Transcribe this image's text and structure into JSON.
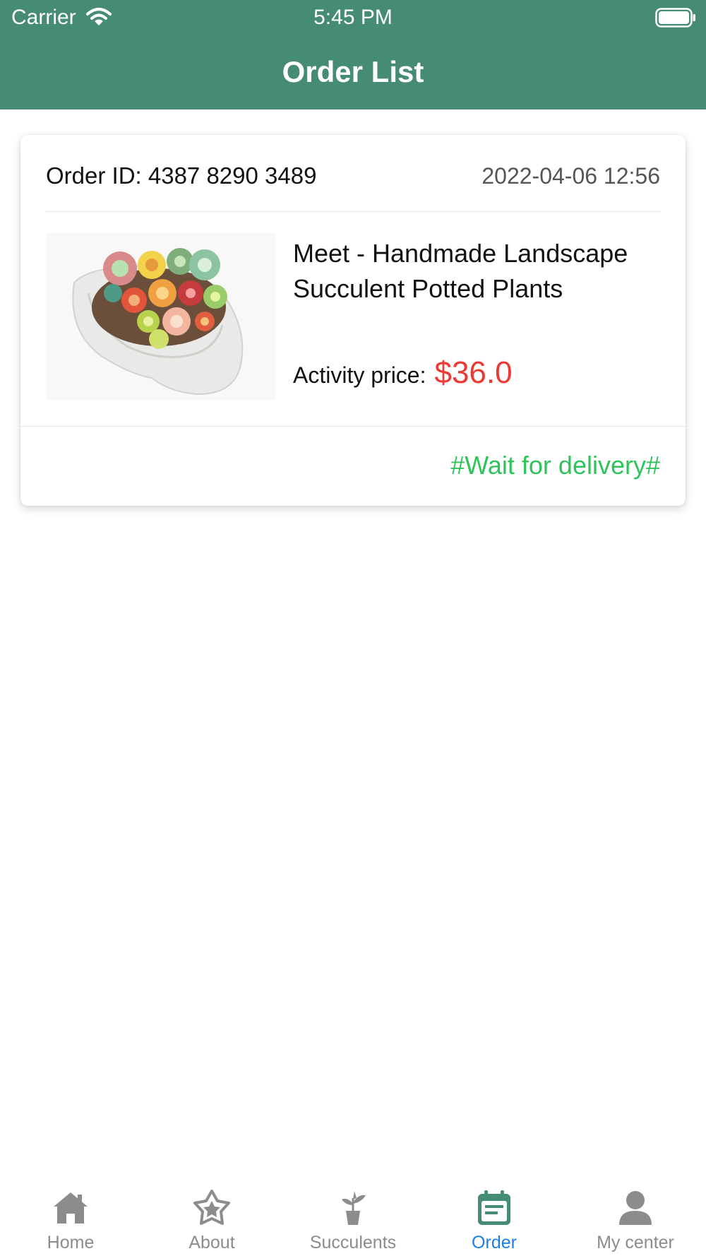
{
  "status_bar": {
    "carrier": "Carrier",
    "time": "5:45 PM",
    "icons": [
      "wifi-icon",
      "battery-icon"
    ]
  },
  "header": {
    "title": "Order List",
    "background_color": "#468b73"
  },
  "orders": [
    {
      "order_id_text": "Order ID: 4387 8290 3489",
      "datetime": "2022-04-06 12:56",
      "product_name": "Meet - Handmade Landscape Succulent Potted Plants",
      "price_label": "Activity price:",
      "price": "$36.0",
      "status": "#Wait for delivery#",
      "price_color": "#ea3a33",
      "status_color": "#2fc35a"
    }
  ],
  "tabbar": {
    "active_color": "#1a7fe6",
    "inactive_color": "#8c8c8c",
    "items": [
      {
        "label": "Home",
        "icon": "home-icon",
        "active": false
      },
      {
        "label": "About",
        "icon": "star-icon",
        "active": false
      },
      {
        "label": "Succulents",
        "icon": "plant-pot-icon",
        "active": false
      },
      {
        "label": "Order",
        "icon": "calendar-list-icon",
        "active": true
      },
      {
        "label": "My center",
        "icon": "person-icon",
        "active": false
      }
    ]
  }
}
